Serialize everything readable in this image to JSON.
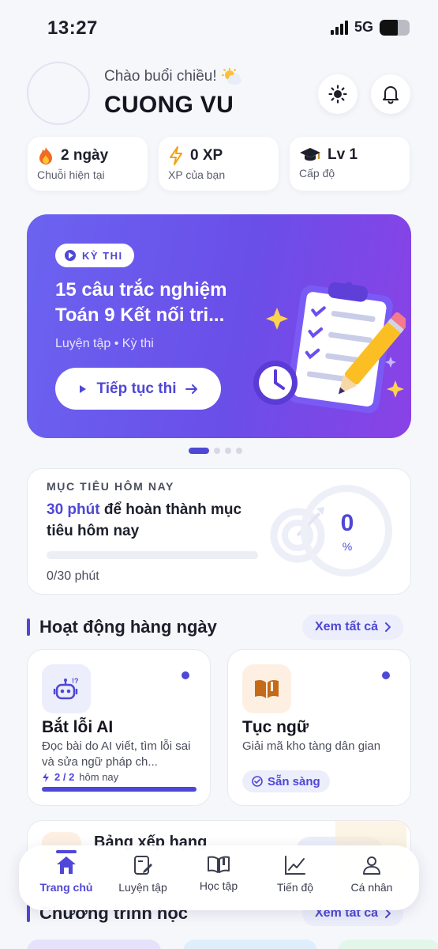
{
  "status_bar": {
    "time": "13:27",
    "network": "5G"
  },
  "header": {
    "greeting": "Chào buổi chiều!",
    "user_name": "CUONG VU"
  },
  "stats": [
    {
      "icon": "fire-icon",
      "value": "2 ngày",
      "label": "Chuỗi hiện tại"
    },
    {
      "icon": "lightning-icon",
      "value": "0 XP",
      "label": "XP của bạn"
    },
    {
      "icon": "graduation-cap-icon",
      "value": "Lv 1",
      "label": "Cấp độ"
    }
  ],
  "banner": {
    "chip": "KỲ THI",
    "title": "15 câu trắc nghiệm Toán 9 Kết nối tri...",
    "subtitle": "Luyện tập • Kỳ thi",
    "cta": "Tiếp tục thi",
    "slide_count": 4,
    "active_slide": 1
  },
  "goal": {
    "label": "MỤC TIÊU HÔM NAY",
    "highlight": "30 phút",
    "text": " để hoàn thành mục tiêu hôm nay",
    "count": "0/30 phút",
    "percent_value": "0",
    "percent_sign": "%",
    "progress": 0
  },
  "daily": {
    "title": "Hoạt động hàng ngày",
    "see_all": "Xem tất cả",
    "cards": [
      {
        "icon": "robot-icon",
        "title": "Bắt lỗi AI",
        "desc": "Đọc bài do AI viết, tìm lỗi sai và sửa ngữ pháp ch...",
        "count": "2 / 2",
        "count_suffix": "hôm nay",
        "progress": 1
      },
      {
        "icon": "book-icon",
        "title": "Tục ngữ",
        "desc": "Giải mã kho tàng dân gian",
        "status": "Sẵn sàng"
      }
    ]
  },
  "leaderboard": {
    "title": "Bảng xếp hạng"
  },
  "programs": {
    "title": "Chương trình học",
    "see_all": "Xem tất cả"
  },
  "nav": [
    {
      "icon": "home-icon",
      "label": "Trang chủ",
      "active": true
    },
    {
      "icon": "practice-icon",
      "label": "Luyện tập"
    },
    {
      "icon": "open-book-icon",
      "label": "Học tập"
    },
    {
      "icon": "chart-icon",
      "label": "Tiến độ"
    },
    {
      "icon": "user-icon",
      "label": "Cá nhân"
    }
  ],
  "colors": {
    "accent": "#4f47d6",
    "banner_start": "#6b63f0",
    "banner_end": "#8a42e6",
    "background": "#f6f7fb"
  }
}
